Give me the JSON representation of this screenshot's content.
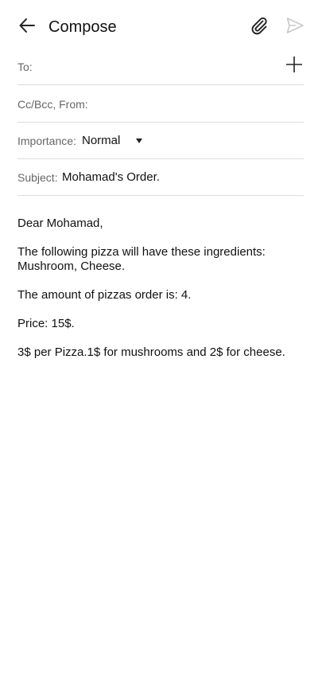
{
  "header": {
    "title": "Compose",
    "icons": {
      "back": "arrow-left-icon",
      "attach": "paperclip-icon",
      "send": "send-icon"
    }
  },
  "fields": {
    "to_label": "To:",
    "to_value": "",
    "cc_label": "Cc/Bcc, From:",
    "importance_label": "Importance:",
    "importance_value": "Normal",
    "subject_label": "Subject:",
    "subject_value": "Mohamad's Order."
  },
  "body": {
    "lines": [
      "Dear Mohamad,",
      "The following pizza will have these ingredients: Mushroom, Cheese.",
      "The amount of pizzas order is: 4.",
      "Price: 15$.",
      "3$ per Pizza.1$ for mushrooms and 2$ for cheese."
    ]
  },
  "colors": {
    "text": "#111111",
    "label": "#666666",
    "divider": "#dddddd",
    "send_disabled": "#c8c8c8"
  }
}
